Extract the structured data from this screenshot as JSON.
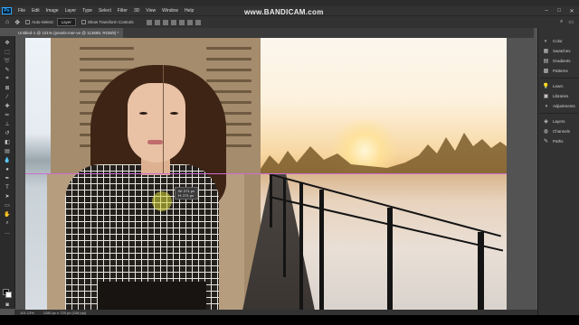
{
  "watermark": "www.BANDICAM.com",
  "menu": [
    "File",
    "Edit",
    "Image",
    "Layer",
    "Type",
    "Select",
    "Filter",
    "3D",
    "View",
    "Window",
    "Help"
  ],
  "app_icon": "Ps",
  "options": {
    "auto_select_label": "Auto-Select:",
    "auto_select_value": "Layer",
    "show_transform_label": "Show Transform Controls"
  },
  "document_tab": "Untitled-1 @ 101% (pexels-mer-ve @ 113689, RGB/8) *",
  "tooltip": {
    "line1": "W: 271 px",
    "line2": "H: 271 px"
  },
  "panels": [
    {
      "icon": "color-icon",
      "label": "Color"
    },
    {
      "icon": "swatches-icon",
      "label": "Swatches"
    },
    {
      "icon": "gradients-icon",
      "label": "Gradients"
    },
    {
      "icon": "patterns-icon",
      "label": "Patterns"
    },
    {
      "icon": "learn-icon",
      "label": "Learn"
    },
    {
      "icon": "libraries-icon",
      "label": "Libraries"
    },
    {
      "icon": "adjustments-icon",
      "label": "Adjustments"
    },
    {
      "icon": "layers-icon",
      "label": "Layers"
    },
    {
      "icon": "channels-icon",
      "label": "Channels"
    },
    {
      "icon": "paths-icon",
      "label": "Paths"
    }
  ],
  "status": {
    "zoom": "101.13%",
    "doc": "1280 px x 720 px (108 ppi)"
  },
  "colors": {
    "accent": "#31a8ff",
    "guide": "#d06bd0",
    "panel": "#323232",
    "canvas_bg": "#535353"
  }
}
